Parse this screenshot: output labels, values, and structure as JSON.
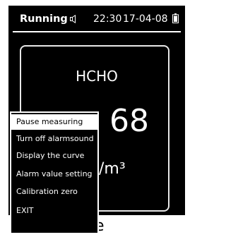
{
  "status_bar": {
    "state": "Running",
    "sound_icon": "speaker-muted-icon",
    "time": "22:30",
    "date": "17-04-08",
    "battery_icon": "battery-icon"
  },
  "reading": {
    "gas": "HCHO",
    "value_visible": "68",
    "unit_visible": "/m³"
  },
  "bottom_bar": {
    "text_visible": "e"
  },
  "menu": {
    "selected_index": 0,
    "items": [
      "Pause measuring",
      "Turn off alarmsound",
      "Display the curve",
      "Alarm value setting",
      "Calibration zero",
      "EXIT"
    ]
  },
  "colors": {
    "screen_bg": "#000000",
    "foreground": "#ffffff"
  }
}
